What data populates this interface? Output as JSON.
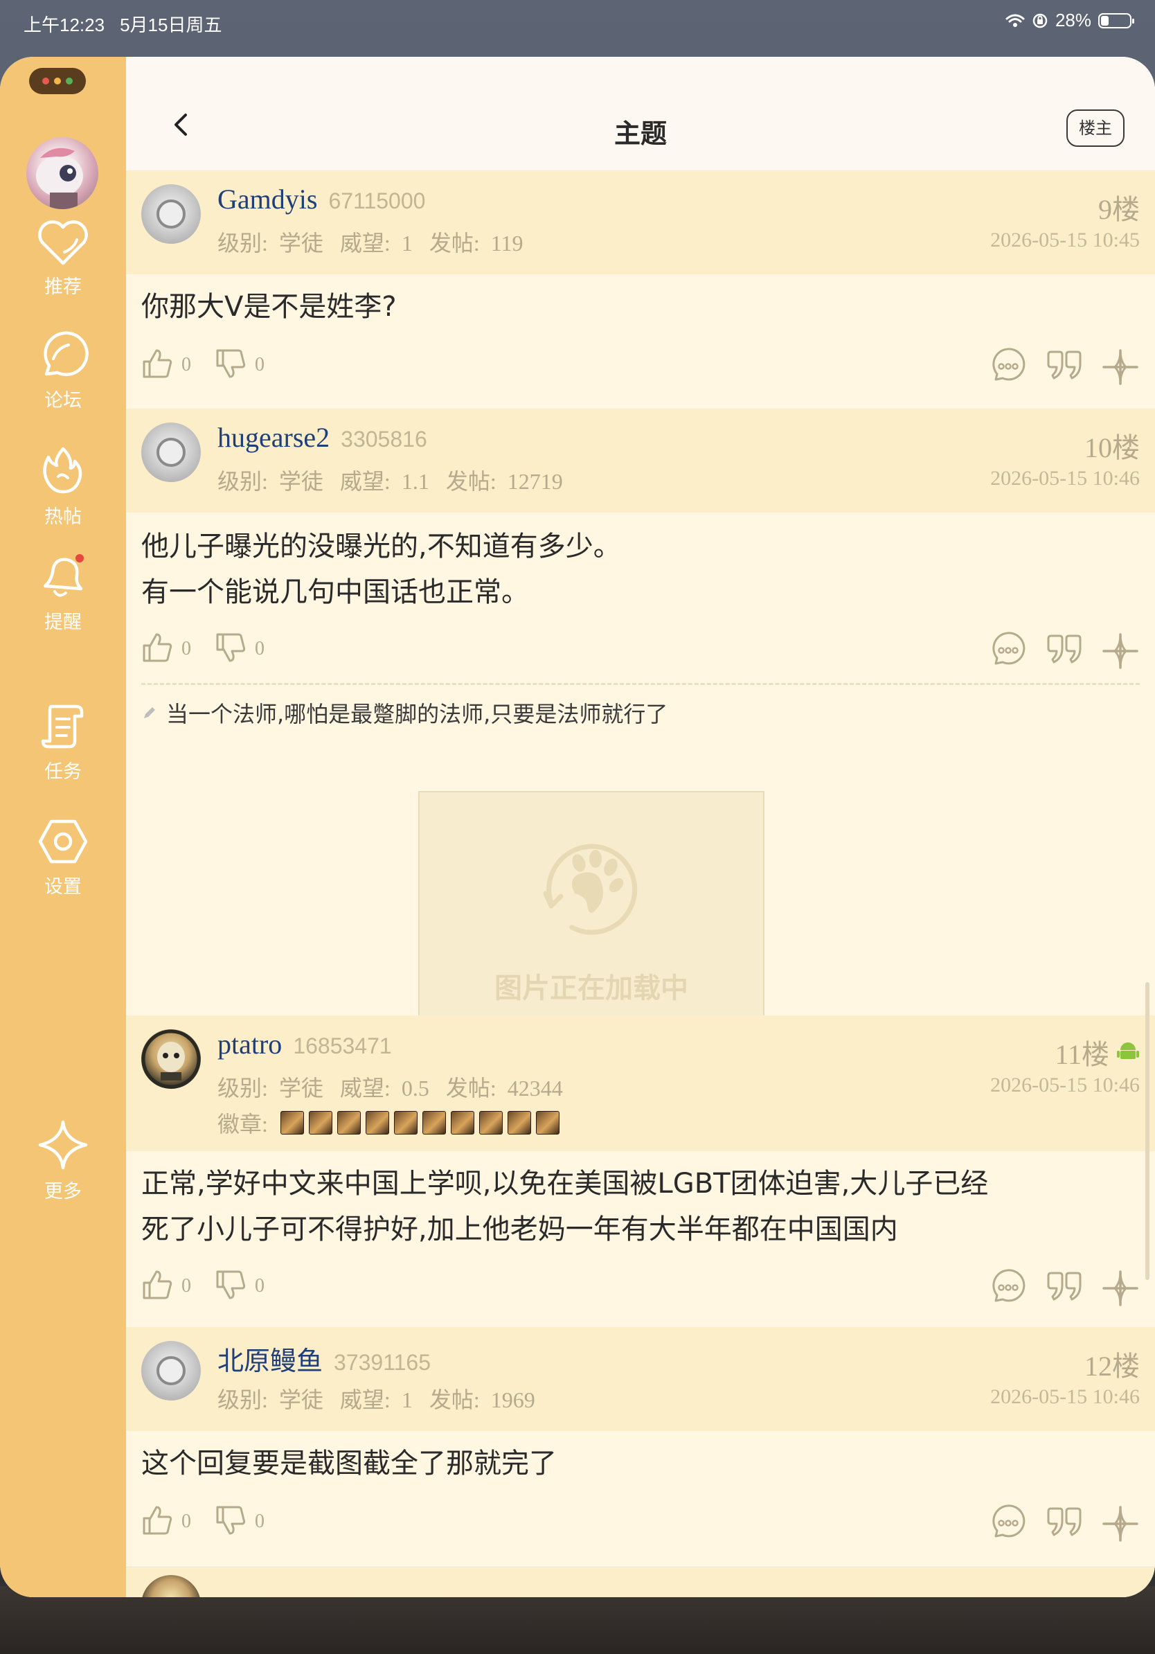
{
  "status_bar": {
    "time": "上午12:23",
    "date": "5月15日周五",
    "battery": "28%",
    "battery_level": 0.28
  },
  "window_dots_colors": [
    "#e85a4f",
    "#f2b64b",
    "#58b05a"
  ],
  "header": {
    "title": "主题",
    "op_button": "楼主"
  },
  "sidebar": {
    "items": [
      {
        "label": "推荐",
        "icon": "heart-icon"
      },
      {
        "label": "论坛",
        "icon": "chat-bubble-icon"
      },
      {
        "label": "热帖",
        "icon": "flame-icon"
      },
      {
        "label": "提醒",
        "icon": "bell-icon"
      },
      {
        "label": "任务",
        "icon": "scroll-icon"
      },
      {
        "label": "设置",
        "icon": "hexagon-gear-icon"
      },
      {
        "label": "更多",
        "icon": "sparkle-icon"
      }
    ]
  },
  "meta_labels": {
    "level": "级别:",
    "prestige": "威望:",
    "posts": "发帖:",
    "badges": "徽章:"
  },
  "posts": [
    {
      "username": "Gamdyis",
      "uid": "67115000",
      "level": "学徒",
      "prestige": "1",
      "post_count": "119",
      "floor": "9楼",
      "time": "2026-05-15 10:45",
      "content": [
        "你那大V是不是姓李?"
      ],
      "likes": "0",
      "dislikes": "0"
    },
    {
      "username": "hugearse2",
      "uid": "3305816",
      "level": "学徒",
      "prestige": "1.1",
      "post_count": "12719",
      "floor": "10楼",
      "time": "2026-05-15 10:46",
      "content": [
        "他儿子曝光的没曝光的,不知道有多少。",
        "有一个能说几句中国话也正常。"
      ],
      "likes": "0",
      "dislikes": "0",
      "signature": "当一个法师,哪怕是最蹩脚的法师,只要是法师就行了",
      "image_loading_text": "图片正在加载中"
    },
    {
      "username": "ptatro",
      "uid": "16853471",
      "level": "学徒",
      "prestige": "0.5",
      "post_count": "42344",
      "floor": "11楼",
      "time": "2026-05-15 10:46",
      "content": [
        "正常,学好中文来中国上学呗,以免在美国被LGBT团体迫害,大儿子已经",
        "死了小儿子可不得护好,加上他老妈一年有大半年都在中国国内"
      ],
      "likes": "0",
      "dislikes": "0",
      "badge_count": 10,
      "client_icon": "android-icon",
      "client_color": "#8cc43c"
    },
    {
      "username": "北原鳗鱼",
      "uid": "37391165",
      "level": "学徒",
      "prestige": "1",
      "post_count": "1969",
      "floor": "12楼",
      "time": "2026-05-15 10:46",
      "content": [
        "这个回复要是截图截全了那就完了"
      ],
      "likes": "0",
      "dislikes": "0"
    }
  ],
  "colors": {
    "sidebar": "#f3c574",
    "username": "#1f3f7a",
    "muted": "#b6aa8c",
    "header_bg": "#fbeec9"
  }
}
